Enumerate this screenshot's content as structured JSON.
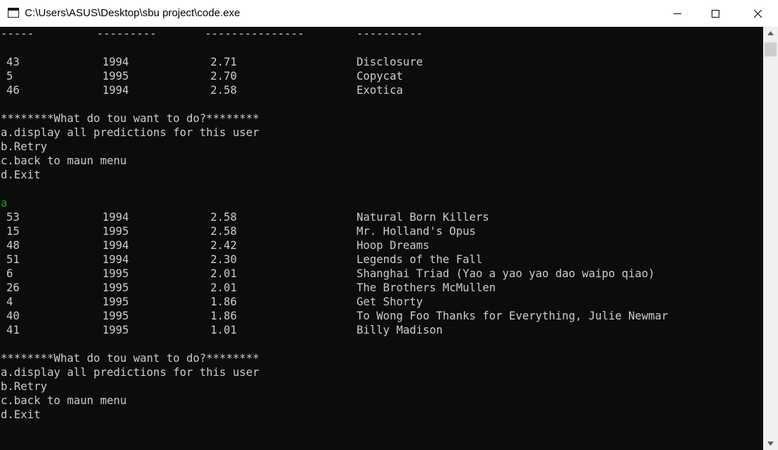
{
  "window": {
    "title": "C:\\Users\\ASUS\\Desktop\\sbu project\\code.exe",
    "controls": {
      "minimize": "minimize",
      "maximize": "maximize",
      "close": "close"
    }
  },
  "console": {
    "header_rule": [
      "-----",
      "---------",
      "---------------",
      "----------"
    ],
    "results_1": [
      {
        "id": "43",
        "year": "1994",
        "score": "2.71",
        "title": "Disclosure"
      },
      {
        "id": "5",
        "year": "1995",
        "score": "2.70",
        "title": "Copycat"
      },
      {
        "id": "46",
        "year": "1994",
        "score": "2.58",
        "title": "Exotica"
      }
    ],
    "menu_1": [
      "********What do tou want to do?********",
      "a.display all predictions for this user",
      "b.Retry",
      "c.back to maun menu",
      "d.Exit"
    ],
    "user_input": "a",
    "results_2": [
      {
        "id": "53",
        "year": "1994",
        "score": "2.58",
        "title": "Natural Born Killers"
      },
      {
        "id": "15",
        "year": "1995",
        "score": "2.58",
        "title": "Mr. Holland's Opus"
      },
      {
        "id": "48",
        "year": "1994",
        "score": "2.42",
        "title": "Hoop Dreams"
      },
      {
        "id": "51",
        "year": "1994",
        "score": "2.30",
        "title": "Legends of the Fall"
      },
      {
        "id": "6",
        "year": "1995",
        "score": "2.01",
        "title": "Shanghai Triad (Yao a yao yao dao waipo qiao)"
      },
      {
        "id": "26",
        "year": "1995",
        "score": "2.01",
        "title": "The Brothers McMullen"
      },
      {
        "id": "4",
        "year": "1995",
        "score": "1.86",
        "title": "Get Shorty"
      },
      {
        "id": "40",
        "year": "1995",
        "score": "1.86",
        "title": "To Wong Foo Thanks for Everything, Julie Newmar"
      },
      {
        "id": "41",
        "year": "1995",
        "score": "1.01",
        "title": "Billy Madison"
      }
    ],
    "menu_2": [
      "********What do tou want to do?********",
      "a.display all predictions for this user",
      "b.Retry",
      "c.back to maun menu",
      "d.Exit"
    ]
  },
  "colors": {
    "console_bg": "#0c0c0c",
    "console_text": "#cccccc",
    "input_text": "#13a10e",
    "titlebar_bg": "#ffffff"
  }
}
